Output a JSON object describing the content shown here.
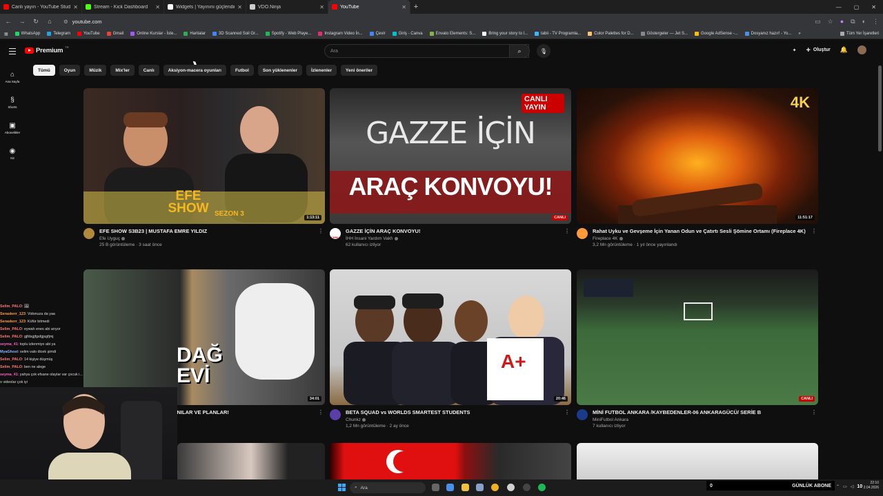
{
  "browser": {
    "tabs": [
      {
        "title": "Canlı yayın - YouTube Studio",
        "color": "#ff0000"
      },
      {
        "title": "Stream - Kick Dashboard",
        "color": "#53fc18"
      },
      {
        "title": "Widgets | Yayınını güçlendirme",
        "color": "#ffffff"
      },
      {
        "title": "VDO.Ninja",
        "color": "#cccccc"
      },
      {
        "title": "YouTube",
        "color": "#ff0000",
        "active": true
      }
    ],
    "url": "youtube.com",
    "bookmarks": [
      "WhatsApp",
      "Telegram",
      "YouTube",
      "Gmail",
      "Online Kurslar - İste...",
      "Haritalar",
      "3D Scanned Soil Gr...",
      "Spotify - Web Playe...",
      "Instagram Video İn...",
      "Çevir",
      "Giriş - Canva",
      "Envato Elements: S...",
      "Bring your story to l...",
      "tabii - TV Programla...",
      "Color Palettes for D...",
      "Göstergeler — Jet S...",
      "Google AdSense -...",
      "Dosyanız hazır! - Yo..."
    ],
    "all_bookmarks": "Tüm Yer İşaretleri"
  },
  "yt": {
    "brand": "Premium",
    "brand_sup": "TR",
    "search_placeholder": "Ara",
    "create": "Oluştur",
    "sidebar": [
      {
        "icon": "⌂",
        "label": "Ana Sayfa"
      },
      {
        "icon": "§",
        "label": "Shorts"
      },
      {
        "icon": "▣",
        "label": "Abonelikler"
      },
      {
        "icon": "◉",
        "label": "Siz"
      }
    ],
    "chips": [
      "Tümü",
      "Oyun",
      "Müzik",
      "Mix'ler",
      "Canlı",
      "Aksiyon-macera oyunları",
      "Futbol",
      "Son yüklenenler",
      "İzlenenler",
      "Yeni öneriler"
    ],
    "videos": [
      {
        "title": "EFE SHOW S3B23 | MUSTAFA EMRE YILDIZ",
        "channel": "Efe Uyguç",
        "stats": "25 B görüntüleme · 3 saat önce",
        "duration": "1:13:11",
        "thumb_text": "EFE SHOW",
        "thumb_sub": "SEZON 3"
      },
      {
        "title": "GAZZE İÇİN ARAÇ KONVOYU!",
        "channel": "İHH İnsani Yardım Vakfı",
        "stats": "62 kullanıcı izliyor",
        "live": "CANLI",
        "thumb_text1": "GAZZE İÇİN",
        "thumb_text2": "ARAÇ KONVOYU!",
        "thumb_badge": "CANLI YAYIN",
        "avatar_text": "CANLI"
      },
      {
        "title": "Rahat Uyku ve Gevşeme İçin Yanan Odun ve Çatırtı Sesli Şömine Ortamı (Fireplace 4K)",
        "channel": "Fireplace 4K",
        "stats": "3,2 Mn görüntüleme · 1 yıl önce yayınlandı",
        "duration": "11:51:17",
        "thumb_text": "4K"
      },
      {
        "title": "…NILAR VE PLANLAR!",
        "duration": "34:01",
        "thumb_text": "DAĞ EVİ"
      },
      {
        "title": "BETA SQUAD vs WORLDS SMARTEST STUDENTS",
        "channel": "Chunkz",
        "stats": "1,2 Mn görüntüleme · 2 ay önce",
        "duration": "20:46",
        "thumb_text": "A+"
      },
      {
        "title": "MİNİ FUTBOL ANKARA /KAYBEDENLER-06 ANKARAGÜCÜ/ SERİE B",
        "channel": "MiniFutbol Ankara",
        "stats": "7 kullanıcı izliyor",
        "live": "CANLI"
      }
    ]
  },
  "chat": [
    {
      "user": "Selim_PALO",
      "color": "#ff7a7a",
      "text": ": 🖼"
    },
    {
      "user": "Seraskerr_123",
      "color": "#ff9d3c",
      "text": ": Vidonuza da yaa"
    },
    {
      "user": "Seraskerr_123",
      "color": "#ff9d3c",
      "text": ": Küfür bitmedi"
    },
    {
      "user": "Selim_PALO",
      "color": "#ff7a7a",
      "text": ": eywah enes abi arıyor"
    },
    {
      "user": "Selim_PALO",
      "color": "#ff7a7a",
      "text": ": gjfdsgjfgsfgjsgfjmj"
    },
    {
      "user": "seyma_41",
      "color": "#ff5cc8",
      "text": ": toplu izlenmiyo abi ya"
    },
    {
      "user": "MyaGhost",
      "color": "#8ab4ff",
      "text": ": selim valo dicek şimdi"
    },
    {
      "user": "Selim_PALO",
      "color": "#ff7a7a",
      "text": ": 14 kişiye düşmüş"
    },
    {
      "user": "Selim_PALO",
      "color": "#ff7a7a",
      "text": ": ben ne alege"
    },
    {
      "user": "seyma_41",
      "color": "#ff5cc8",
      "text": ": yahya çok efsane olaylar var çocuk i..."
    },
    {
      "user": "",
      "color": "#ddd",
      "text": "o videolar çok iyi"
    }
  ],
  "taskbar": {
    "search": "Ara",
    "sub_count": "0",
    "sub_label": "GÜNLÜK ABONE",
    "sub_target": "10",
    "time": "22:10",
    "date": "2.04.2026"
  }
}
